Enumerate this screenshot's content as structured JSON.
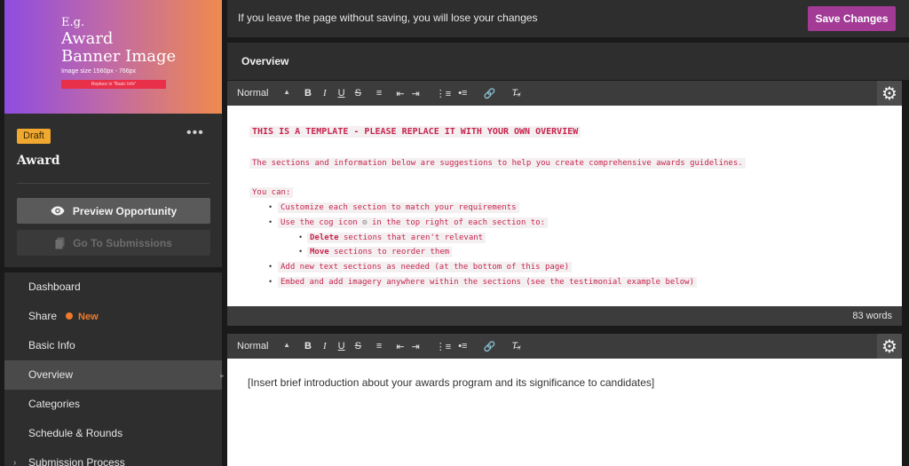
{
  "banner": {
    "eg": "E.g.",
    "line1": "Award",
    "line2": "Banner Image",
    "size_note": "Image size 1560px - 766px",
    "replace_note": "Replace in \"Basic Info\"",
    "gradient_colors": [
      "#8f4ce0",
      "#c16aa6",
      "#ef8a4e"
    ]
  },
  "opportunity": {
    "status_badge": "Draft",
    "title": "Award",
    "more_icon": "ellipsis-icon"
  },
  "actions": {
    "preview_label": "Preview Opportunity",
    "preview_icon": "eye-icon",
    "submissions_label": "Go To Submissions",
    "submissions_icon": "document-icon"
  },
  "nav": {
    "items": [
      {
        "label": "Dashboard"
      },
      {
        "label": "Share",
        "badge": "New"
      },
      {
        "label": "Basic Info"
      },
      {
        "label": "Overview",
        "active": true
      },
      {
        "label": "Categories"
      },
      {
        "label": "Schedule & Rounds"
      },
      {
        "label": "Submission Process"
      }
    ]
  },
  "topbar": {
    "warning": "If you leave the page without saving, you will lose your changes",
    "save_label": "Save Changes",
    "save_color": "#a23a96"
  },
  "section": {
    "title": "Overview"
  },
  "toolbar": {
    "format_value": "Normal",
    "buttons": [
      "bold-icon",
      "italic-icon",
      "underline-icon",
      "strikethrough-icon",
      "align-left-icon",
      "outdent-icon",
      "indent-icon",
      "ordered-list-icon",
      "bullet-list-icon",
      "link-icon",
      "clear-format-icon"
    ],
    "gear_icon": "gear-icon"
  },
  "editor1": {
    "heading": "THIS IS A TEMPLATE - PLEASE REPLACE IT WITH YOUR OWN OVERVIEW",
    "intro": "The sections and information below are suggestions to help you create comprehensive awards guidelines.",
    "you_can": "You can:",
    "b1": "Customize each section to match your requirements",
    "b2_pre": "Use the cog icon",
    "b2_post": "in the top right of each section to:",
    "b2a_bold": "Delete",
    "b2a_rest": "sections that aren't relevant",
    "b2b_bold": "Move",
    "b2b_rest": "sections to reorder them",
    "b3": "Add new text sections as needed (at the bottom of this page)",
    "b4": "Embed and add imagery anywhere within the sections (see the testimonial example below)"
  },
  "word_count": "83 words",
  "editor2": {
    "text": "[Insert brief introduction about your awards program and its significance to candidates]"
  }
}
